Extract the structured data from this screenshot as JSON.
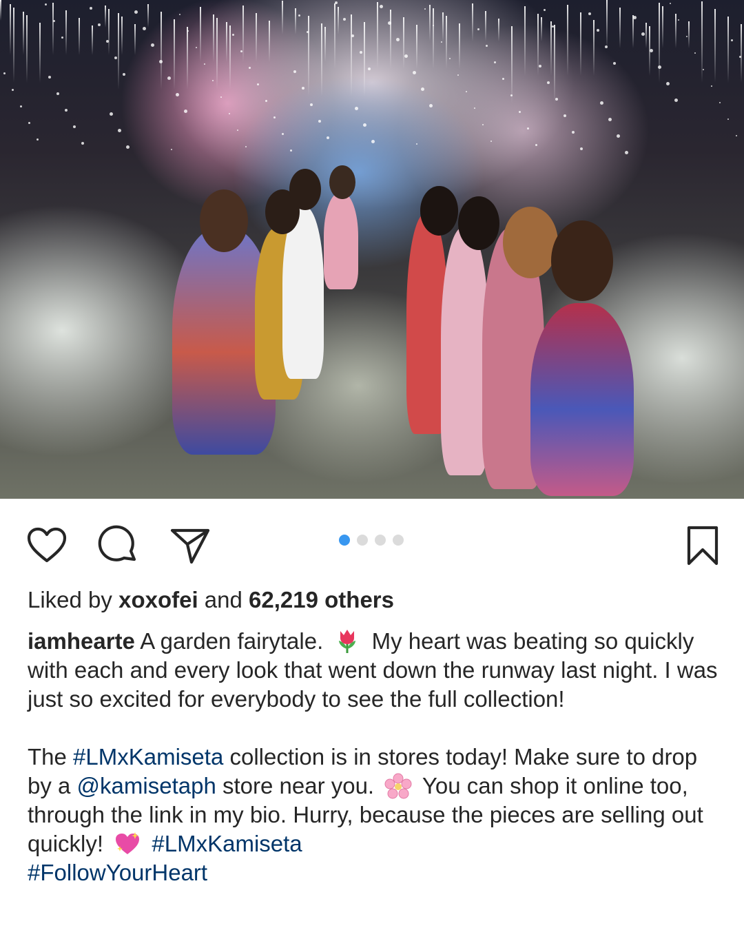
{
  "post": {
    "photo": {
      "description_icon": "runway-photo",
      "carousel_index": 1,
      "carousel_count": 4
    },
    "actions": {
      "like_icon": "heart-outline-icon",
      "comment_icon": "comment-bubble-icon",
      "share_icon": "paper-plane-icon",
      "save_icon": "bookmark-outline-icon"
    },
    "likes": {
      "prefix": "Liked by ",
      "user": "xoxofei",
      "middle": " and ",
      "count": "62,219 others"
    },
    "caption": {
      "username": "iamhearte",
      "p1_text_a": " A garden fairytale. ",
      "p1_emoji": "tulip",
      "p1_text_b": " My heart was beating so quickly with each and every look that went down the runway last night. I was just so excited for everybody to see the full collection!",
      "p2_text_a": "The ",
      "p2_tag1": "#LMxKamiseta",
      "p2_text_b": " collection is in stores today! Make sure to drop by a ",
      "p2_mention": "@kamisetaph",
      "p2_text_c": " store near you. ",
      "p2_emoji1": "cherry-blossom",
      "p2_text_d": " You can shop it online too, through the link in my bio. Hurry, because the pieces are selling out quickly! ",
      "p2_emoji2": "sparkling-heart",
      "p2_text_e": " ",
      "p2_tag2": "#LMxKamiseta",
      "p2_tag3": "#FollowYourHeart"
    },
    "colors": {
      "text": "#262626",
      "link": "#003569",
      "dot_active": "#3897f0",
      "dot_inactive": "#dbdbdb"
    }
  }
}
